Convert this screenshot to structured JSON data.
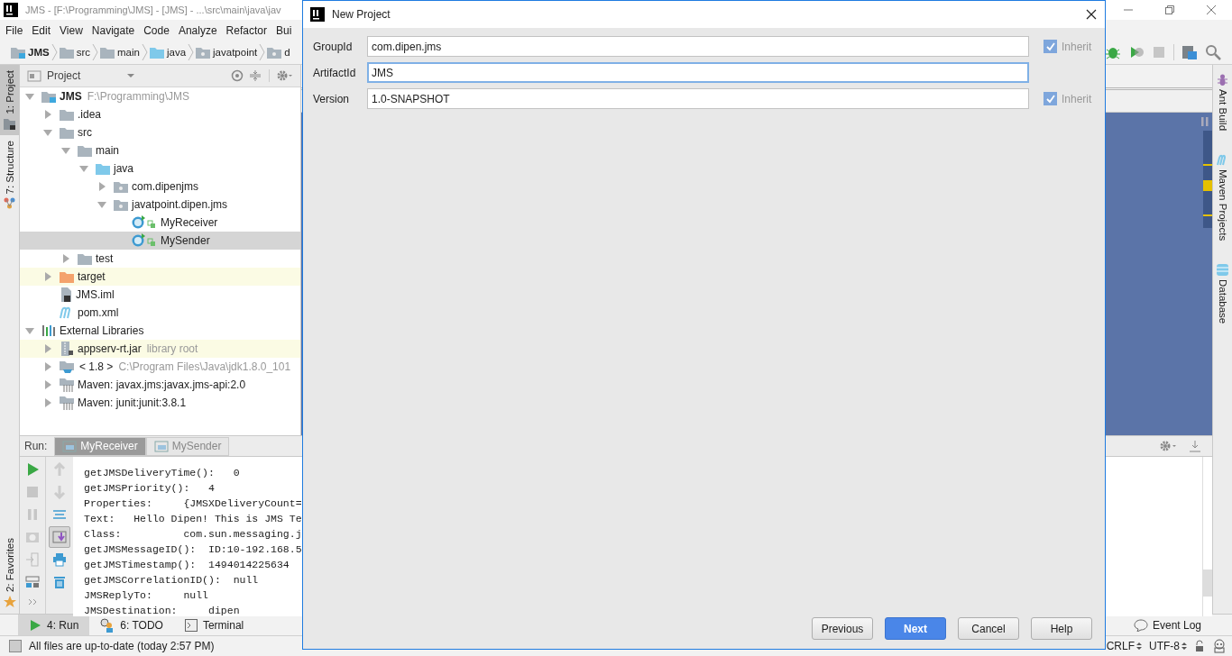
{
  "window": {
    "title": "JMS - [F:\\Programming\\JMS] - [JMS] - ...\\src\\main\\java\\jav"
  },
  "menu": [
    "File",
    "Edit",
    "View",
    "Navigate",
    "Code",
    "Analyze",
    "Refactor",
    "Bui"
  ],
  "breadcrumbs": [
    {
      "label": "JMS",
      "kind": "module"
    },
    {
      "label": "src",
      "kind": "folder"
    },
    {
      "label": "main",
      "kind": "folder"
    },
    {
      "label": "java",
      "kind": "source"
    },
    {
      "label": "javatpoint",
      "kind": "package"
    },
    {
      "label": "d",
      "kind": "package"
    }
  ],
  "left_tool_tabs": [
    {
      "label": "1: Project",
      "kind": "project",
      "selected": true
    },
    {
      "label": "7: Structure",
      "kind": "structure",
      "selected": false
    },
    {
      "label": "2: Favorites",
      "kind": "favorites",
      "selected": false
    }
  ],
  "right_tool_tabs": [
    {
      "label": "Ant Build",
      "kind": "ant"
    },
    {
      "label": "Maven Projects",
      "kind": "maven"
    },
    {
      "label": "Database",
      "kind": "database"
    }
  ],
  "project_panel": {
    "title": "Project",
    "tree": [
      {
        "label": "JMS",
        "hint": "F:\\Programming\\JMS",
        "kind": "module",
        "expanded": true,
        "selected": false,
        "highlighted": false,
        "children": [
          {
            "label": ".idea",
            "kind": "folder",
            "expanded": false,
            "selected": false,
            "highlighted": false
          },
          {
            "label": "src",
            "kind": "folder",
            "expanded": true,
            "selected": false,
            "highlighted": false,
            "children": [
              {
                "label": "main",
                "kind": "folder",
                "expanded": true,
                "selected": false,
                "highlighted": false,
                "children": [
                  {
                    "label": "java",
                    "kind": "source",
                    "expanded": true,
                    "selected": false,
                    "highlighted": false,
                    "children": [
                      {
                        "label": "com.dipenjms",
                        "kind": "package",
                        "expanded": false,
                        "selected": false,
                        "highlighted": false
                      },
                      {
                        "label": "javatpoint.dipen.jms",
                        "kind": "package",
                        "expanded": true,
                        "selected": false,
                        "highlighted": false,
                        "children": [
                          {
                            "label": "MyReceiver",
                            "kind": "class",
                            "selected": false,
                            "highlighted": false
                          },
                          {
                            "label": "MySender",
                            "kind": "class",
                            "selected": true,
                            "highlighted": false
                          }
                        ]
                      }
                    ]
                  }
                ]
              },
              {
                "label": "test",
                "kind": "folder",
                "expanded": false,
                "selected": false,
                "highlighted": false
              }
            ]
          },
          {
            "label": "target",
            "kind": "excluded",
            "expanded": false,
            "selected": false,
            "highlighted": true
          },
          {
            "label": "JMS.iml",
            "kind": "file",
            "selected": false,
            "highlighted": false
          },
          {
            "label": "pom.xml",
            "kind": "maven",
            "selected": false,
            "highlighted": false
          }
        ]
      },
      {
        "label": "External Libraries",
        "kind": "libraries",
        "expanded": true,
        "selected": false,
        "highlighted": false,
        "children": [
          {
            "label": "appserv-rt.jar",
            "hint": "library root",
            "kind": "jar",
            "expanded": false,
            "selected": false,
            "highlighted": true
          },
          {
            "label": "< 1.8 >",
            "hint": "C:\\Program Files\\Java\\jdk1.8.0_101",
            "kind": "jdk",
            "expanded": false,
            "selected": false,
            "highlighted": false
          },
          {
            "label": "Maven: javax.jms:javax.jms-api:2.0",
            "kind": "library",
            "expanded": false,
            "selected": false,
            "highlighted": false
          },
          {
            "label": "Maven: junit:junit:3.8.1",
            "kind": "library",
            "expanded": false,
            "selected": false,
            "highlighted": false
          }
        ]
      }
    ]
  },
  "run_panel": {
    "label": "Run:",
    "tabs": [
      {
        "label": "MyReceiver",
        "selected": true
      },
      {
        "label": "MySender",
        "selected": false
      }
    ],
    "console": [
      "getJMSDeliveryTime():   0",
      "getJMSPriority():   4",
      "Properties:     {JMSXDeliveryCount=",
      "Text:   Hello Dipen! This is JMS Te",
      "Class:          com.sun.messaging.j",
      "getJMSMessageID():  ID:10-192.168.5",
      "getJMSTimestamp():  1494014225634",
      "getJMSCorrelationID():  null",
      "JMSReplyTo:     null",
      "JMSDestination:     dipen"
    ]
  },
  "bottom_tabs": [
    {
      "label": "4: Run",
      "kind": "run",
      "selected": true
    },
    {
      "label": "6: TODO",
      "kind": "todo",
      "selected": false
    },
    {
      "label": "Terminal",
      "kind": "terminal",
      "selected": false
    }
  ],
  "event_log": "Event Log",
  "status_bar": {
    "message": "All files are up-to-date (today 2:57 PM)",
    "line_separator": "CRLF",
    "encoding": "UTF-8"
  },
  "dialog": {
    "title": "New Project",
    "fields": [
      {
        "label": "GroupId",
        "value": "com.dipen.jms",
        "focused": false,
        "inherit": {
          "label": "Inherit",
          "checked": true,
          "disabled": true
        }
      },
      {
        "label": "ArtifactId",
        "value": "JMS",
        "focused": true
      },
      {
        "label": "Version",
        "value": "1.0-SNAPSHOT",
        "focused": false,
        "inherit": {
          "label": "Inherit",
          "checked": true,
          "disabled": true
        }
      }
    ],
    "buttons": [
      {
        "label": "Previous",
        "kind": "normal"
      },
      {
        "label": "Next",
        "kind": "default"
      },
      {
        "label": "Cancel",
        "kind": "normal"
      },
      {
        "label": "Help",
        "kind": "normal"
      }
    ]
  }
}
